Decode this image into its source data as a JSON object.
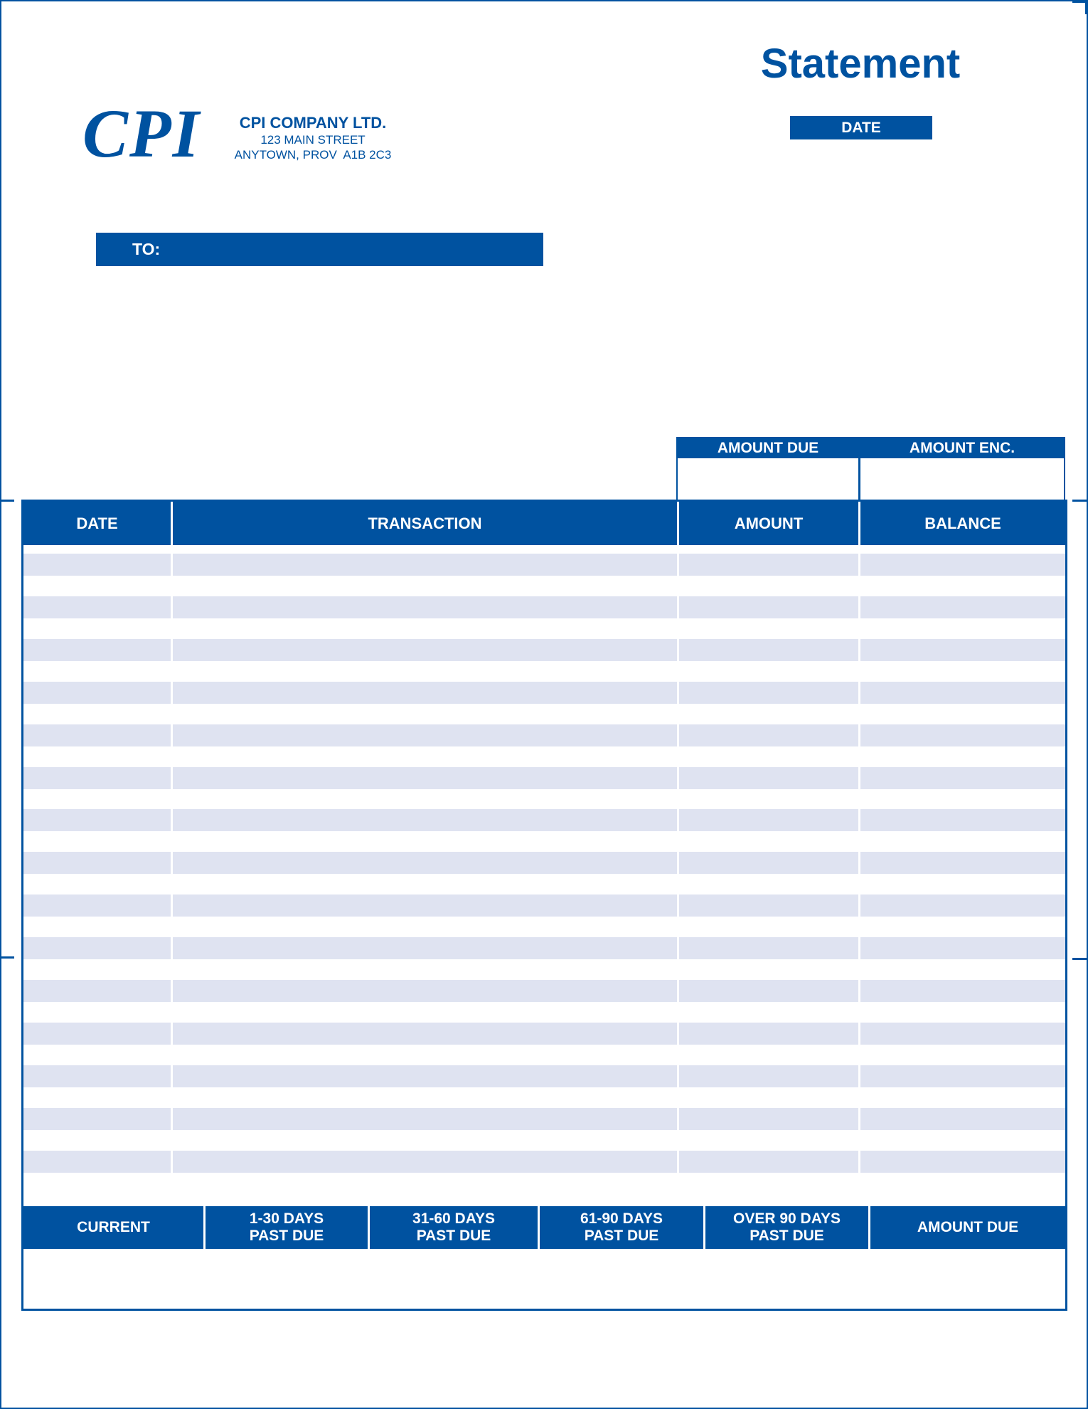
{
  "header": {
    "logo_text": "CPI",
    "company_name": "CPI COMPANY LTD.",
    "address_line1": "123 MAIN STREET",
    "address_line2": "ANYTOWN, PROV  A1B 2C3",
    "title": "Statement",
    "date_label": "DATE",
    "date_value": ""
  },
  "recipient": {
    "to_label": "TO:",
    "to_value": ""
  },
  "remittance": {
    "amount_due_label": "AMOUNT DUE",
    "amount_due_value": "",
    "amount_enc_label": "AMOUNT ENC.",
    "amount_enc_value": ""
  },
  "transactions": {
    "columns": [
      "DATE",
      "TRANSACTION",
      "AMOUNT",
      "BALANCE"
    ],
    "row_count": 15,
    "rows": []
  },
  "aging": {
    "columns": [
      {
        "line1": "CURRENT",
        "line2": ""
      },
      {
        "line1": "1-30 DAYS",
        "line2": "PAST DUE"
      },
      {
        "line1": "31-60 DAYS",
        "line2": "PAST DUE"
      },
      {
        "line1": "61-90 DAYS",
        "line2": "PAST DUE"
      },
      {
        "line1": "OVER 90 DAYS",
        "line2": "PAST DUE"
      },
      {
        "line1": "AMOUNT DUE",
        "line2": ""
      }
    ],
    "values": [
      "",
      "",
      "",
      "",
      "",
      ""
    ]
  },
  "colors": {
    "brand_blue": "#0052a0",
    "stripe": "#dfe3f1"
  }
}
